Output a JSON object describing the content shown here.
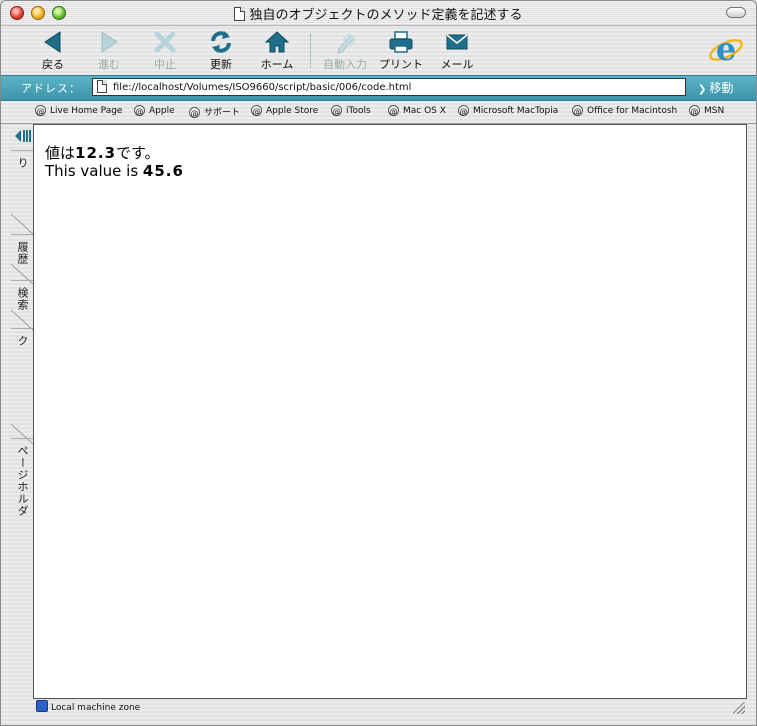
{
  "window": {
    "title": "独自のオブジェクトのメソッド定義を記述する"
  },
  "toolbar": {
    "back": "戻る",
    "forward": "進む",
    "stop": "中止",
    "refresh": "更新",
    "home": "ホーム",
    "autofill": "自動入力",
    "print": "プリント",
    "mail": "メール"
  },
  "address": {
    "label": "アドレス：",
    "url": "file://localhost/Volumes/ISO9660/script/basic/006/code.html",
    "go": "移動"
  },
  "favorites": [
    "Live Home Page",
    "Apple",
    "サポート",
    "Apple Store",
    "iTools",
    "Mac OS X",
    "Microsoft MacTopia",
    "Office for Macintosh",
    "MSN"
  ],
  "sidebar_tabs": [
    "お気に入り",
    "履歴",
    "検索",
    "スクラップブック",
    "ページホルダ"
  ],
  "content": {
    "line1_prefix": "値は",
    "line1_value": "12.3",
    "line1_suffix": "です。",
    "line2_prefix": "This value is ",
    "line2_value": "45.6"
  },
  "status": {
    "zone": "Local machine zone"
  },
  "colors": {
    "accent": "#3c94aa",
    "toolbar_icon": "#1f6f8b"
  }
}
